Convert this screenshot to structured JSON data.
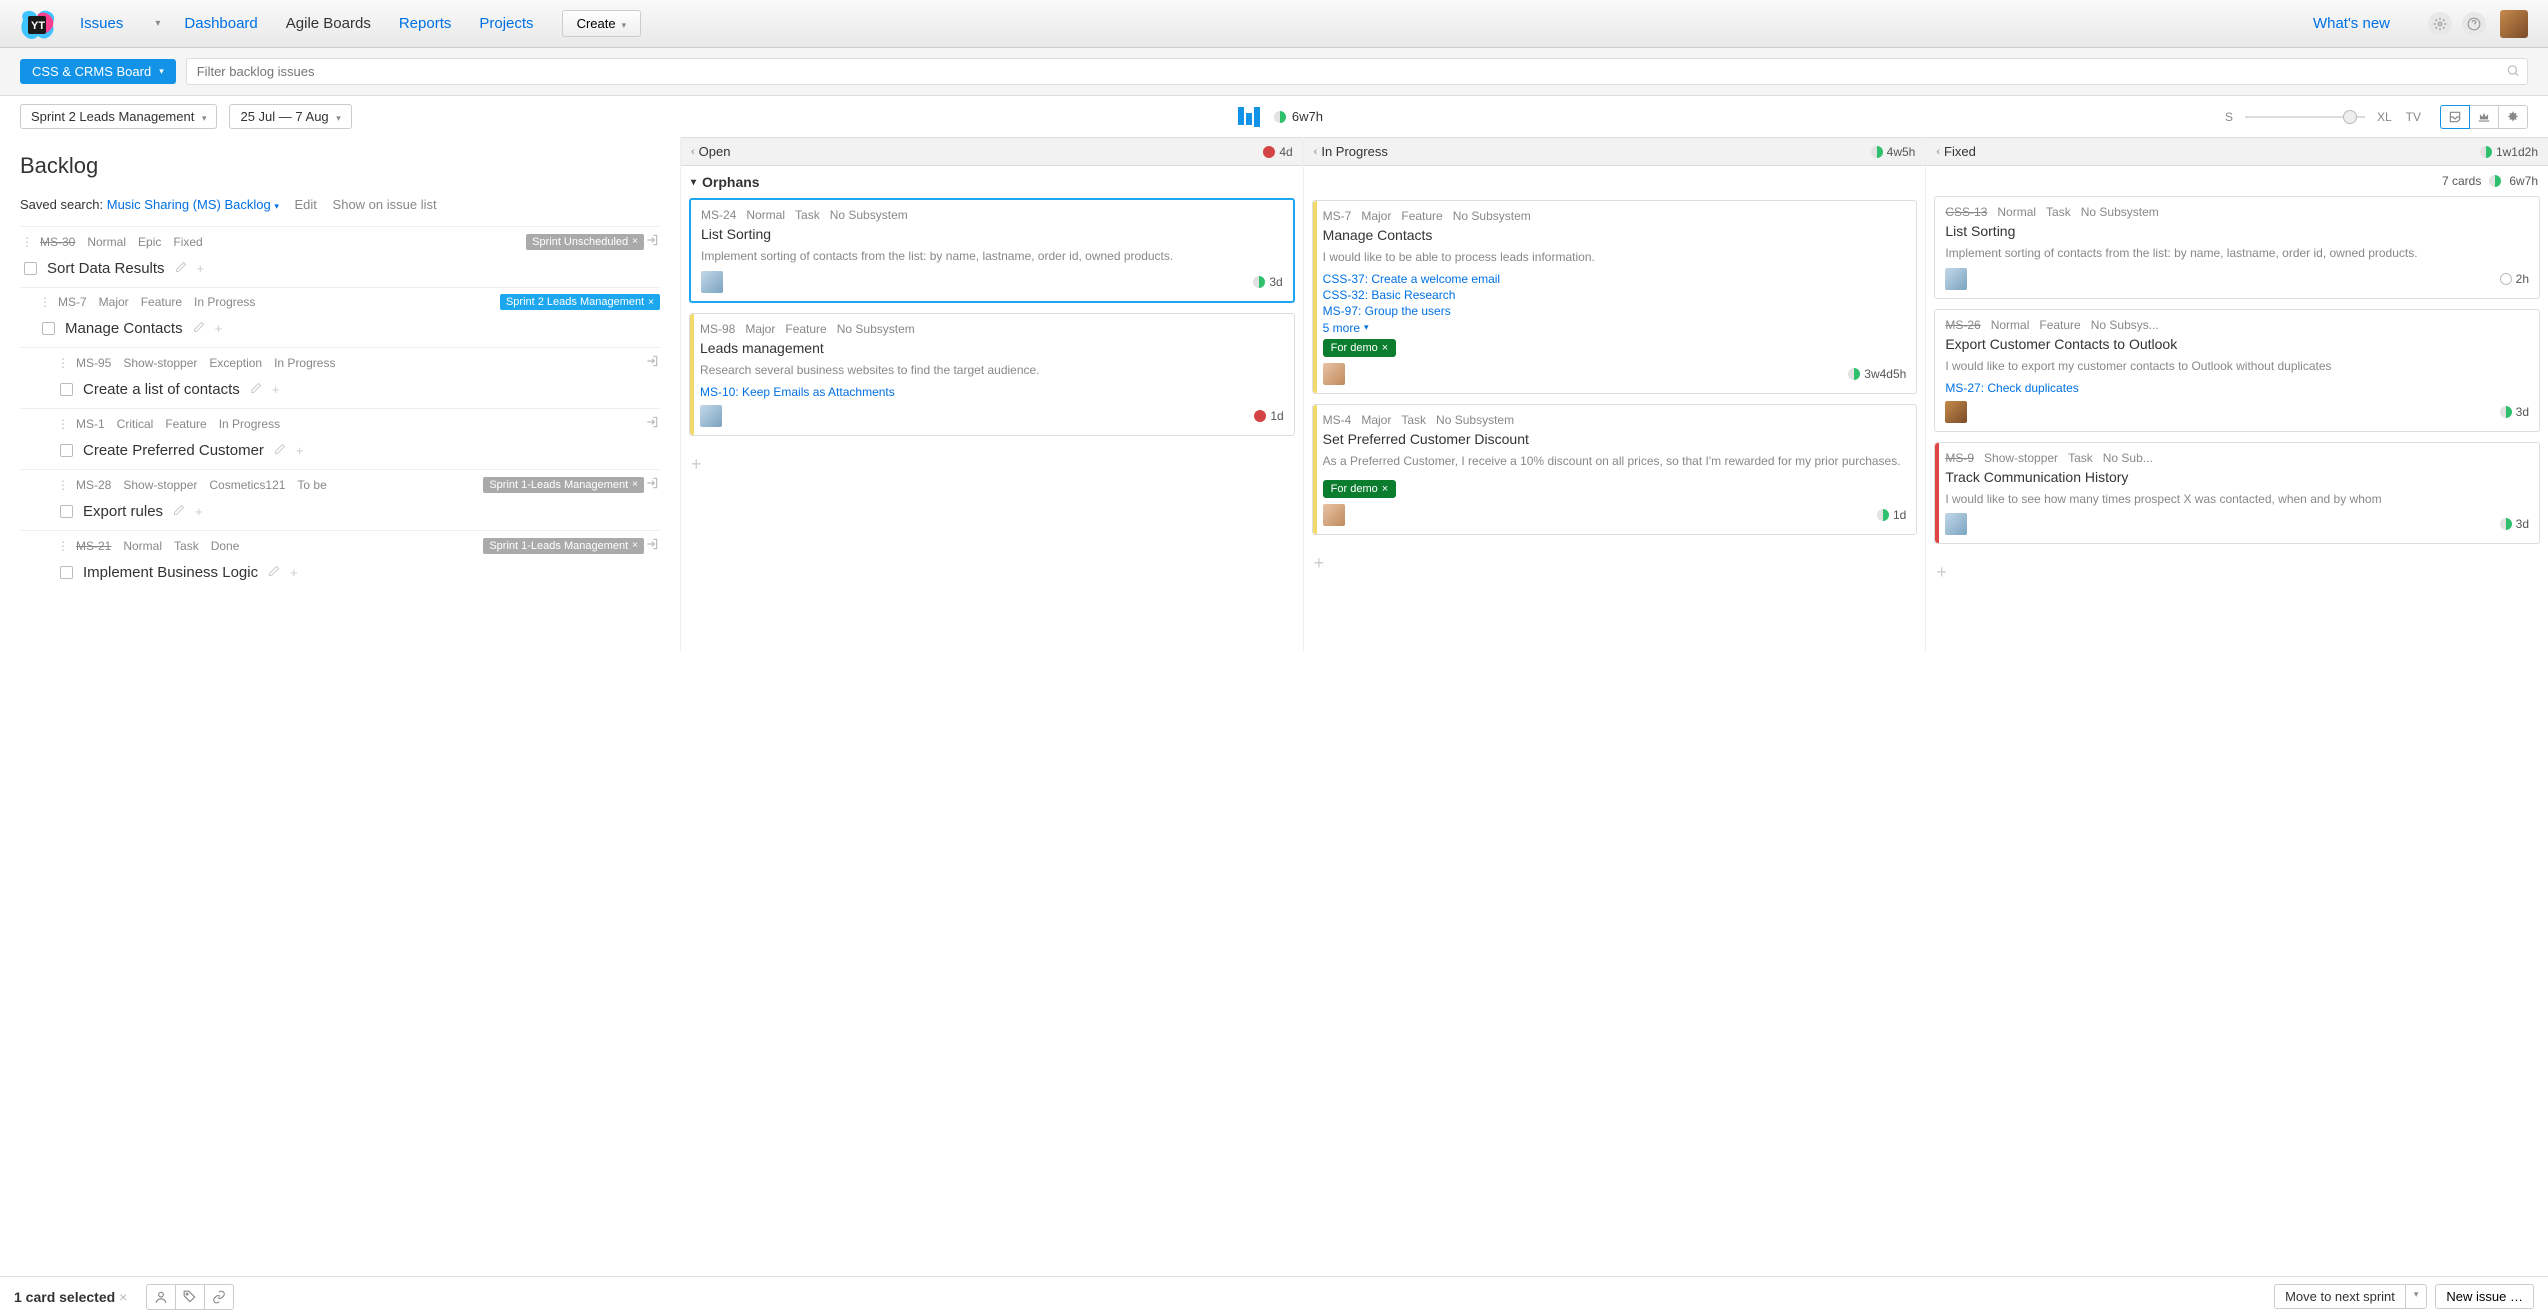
{
  "nav": {
    "issues": "Issues",
    "dashboard": "Dashboard",
    "boards": "Agile Boards",
    "reports": "Reports",
    "projects": "Projects",
    "create": "Create",
    "whatsnew": "What's new"
  },
  "board_bar": {
    "board_name": "CSS & CRMS Board",
    "filter_placeholder": "Filter backlog issues"
  },
  "sprint_bar": {
    "sprint_name": "Sprint 2 Leads Management",
    "date_range": "25 Jul — 7 Aug",
    "total_estimate": "6w7h",
    "size_small": "S",
    "size_xl": "XL",
    "size_tv": "TV"
  },
  "backlog": {
    "title": "Backlog",
    "saved_label": "Saved search:",
    "saved_name": "Music Sharing (MS) Backlog",
    "edit": "Edit",
    "show": "Show on issue list",
    "items": [
      {
        "id": "MS-30",
        "id_struck": true,
        "priority": "Normal",
        "type": "Epic",
        "state": "Fixed",
        "tag": "Sprint Unscheduled",
        "tag_style": "gray",
        "title": "Sort Data Results",
        "indent": 0,
        "move": true
      },
      {
        "id": "MS-7",
        "priority": "Major",
        "type": "Feature",
        "state": "In Progress",
        "tag": "Sprint 2 Leads Management",
        "tag_style": "blue",
        "title": "Manage Contacts",
        "indent": 1
      },
      {
        "id": "MS-95",
        "priority": "Show-stopper",
        "type": "Exception",
        "state": "In Progress",
        "title": "Create a list of contacts",
        "indent": 2,
        "move": true
      },
      {
        "id": "MS-1",
        "priority": "Critical",
        "type": "Feature",
        "state": "In Progress",
        "title": "Create Preferred Customer",
        "indent": 2,
        "move": true
      },
      {
        "id": "MS-28",
        "priority": "Show-stopper",
        "type": "Cosmetics121",
        "state": "To be",
        "tag": "Sprint 1-Leads Management",
        "tag_style": "gray",
        "title": "Export rules",
        "indent": 2,
        "move": true
      },
      {
        "id": "MS-21",
        "id_struck": true,
        "priority": "Normal",
        "type": "Task",
        "state": "Done",
        "tag": "Sprint 1-Leads Management",
        "tag_style": "gray",
        "title": "Implement Business Logic",
        "indent": 2,
        "move": true
      }
    ]
  },
  "columns": {
    "open": {
      "name": "Open",
      "est": "4d",
      "pie": "red"
    },
    "inprogress": {
      "name": "In Progress",
      "est": "4w5h",
      "pie": "green"
    },
    "fixed": {
      "name": "Fixed",
      "est": "1w1d2h",
      "pie": "green"
    }
  },
  "swimlane": {
    "name": "Orphans",
    "cards_label": "7 cards",
    "total": "6w7h"
  },
  "cards": {
    "open": [
      {
        "id": "MS-24",
        "priority": "Normal",
        "type": "Task",
        "sub": "No Subsystem",
        "title": "List Sorting",
        "desc": "Implement sorting of contacts from the list: by name, lastname, order id, owned products.",
        "est": "3d",
        "pie": "green",
        "selected": true,
        "avatar": "a1"
      },
      {
        "id": "MS-98",
        "priority": "Major",
        "type": "Feature",
        "sub": "No Subsystem",
        "title": "Leads management",
        "desc": "Research several business websites to find the target audience.",
        "links": [
          "MS-10: Keep Emails as Attachments"
        ],
        "est": "1d",
        "pie": "red",
        "stripe": "yellow",
        "avatar": "a1"
      }
    ],
    "inprogress": [
      {
        "id": "MS-7",
        "priority": "Major",
        "type": "Feature",
        "sub": "No Subsystem",
        "title": "Manage Contacts",
        "desc": "I would like to be able to process leads information.",
        "links": [
          "CSS-37: Create a welcome email",
          "CSS-32: Basic Research",
          "MS-97: Group the users"
        ],
        "more": "5 more",
        "tag": "For demo",
        "est": "3w4d5h",
        "pie": "green",
        "stripe": "yellow",
        "avatar": "a2"
      },
      {
        "id": "MS-4",
        "priority": "Major",
        "type": "Task",
        "sub": "No Subsystem",
        "title": "Set Preferred Customer Discount",
        "desc": "As a Preferred Customer, I receive a 10% discount on all prices, so that I'm rewarded for my prior purchases.",
        "tag": "For demo",
        "est": "1d",
        "pie": "green-full",
        "stripe": "yellow",
        "avatar": "a2"
      }
    ],
    "fixed": [
      {
        "id": "CSS-13",
        "id_struck": true,
        "priority": "Normal",
        "type": "Task",
        "sub": "No Subsystem",
        "title": "List Sorting",
        "desc": "Implement sorting of contacts from the list: by name, lastname, order id, owned products.",
        "est": "2h",
        "pie": "empty",
        "avatar": "a1"
      },
      {
        "id": "MS-26",
        "id_struck": true,
        "priority": "Normal",
        "type": "Feature",
        "sub": "No Subsys...",
        "title": "Export Customer Contacts to Outlook",
        "desc": "I would like to export my customer contacts to Outlook without duplicates",
        "links": [
          "MS-27: Check duplicates"
        ],
        "est": "3d",
        "pie": "green",
        "avatar": "a3"
      },
      {
        "id": "MS-9",
        "id_struck": true,
        "priority": "Show-stopper",
        "type": "Task",
        "sub": "No Sub...",
        "title": "Track Communication History",
        "desc": "I would like to see how many times prospect X was contacted, when and by whom",
        "est": "3d",
        "pie": "green",
        "stripe": "red",
        "avatar": "a1"
      }
    ]
  },
  "bottom": {
    "selected": "1 card selected",
    "move": "Move to next sprint",
    "newissue": "New issue …"
  }
}
